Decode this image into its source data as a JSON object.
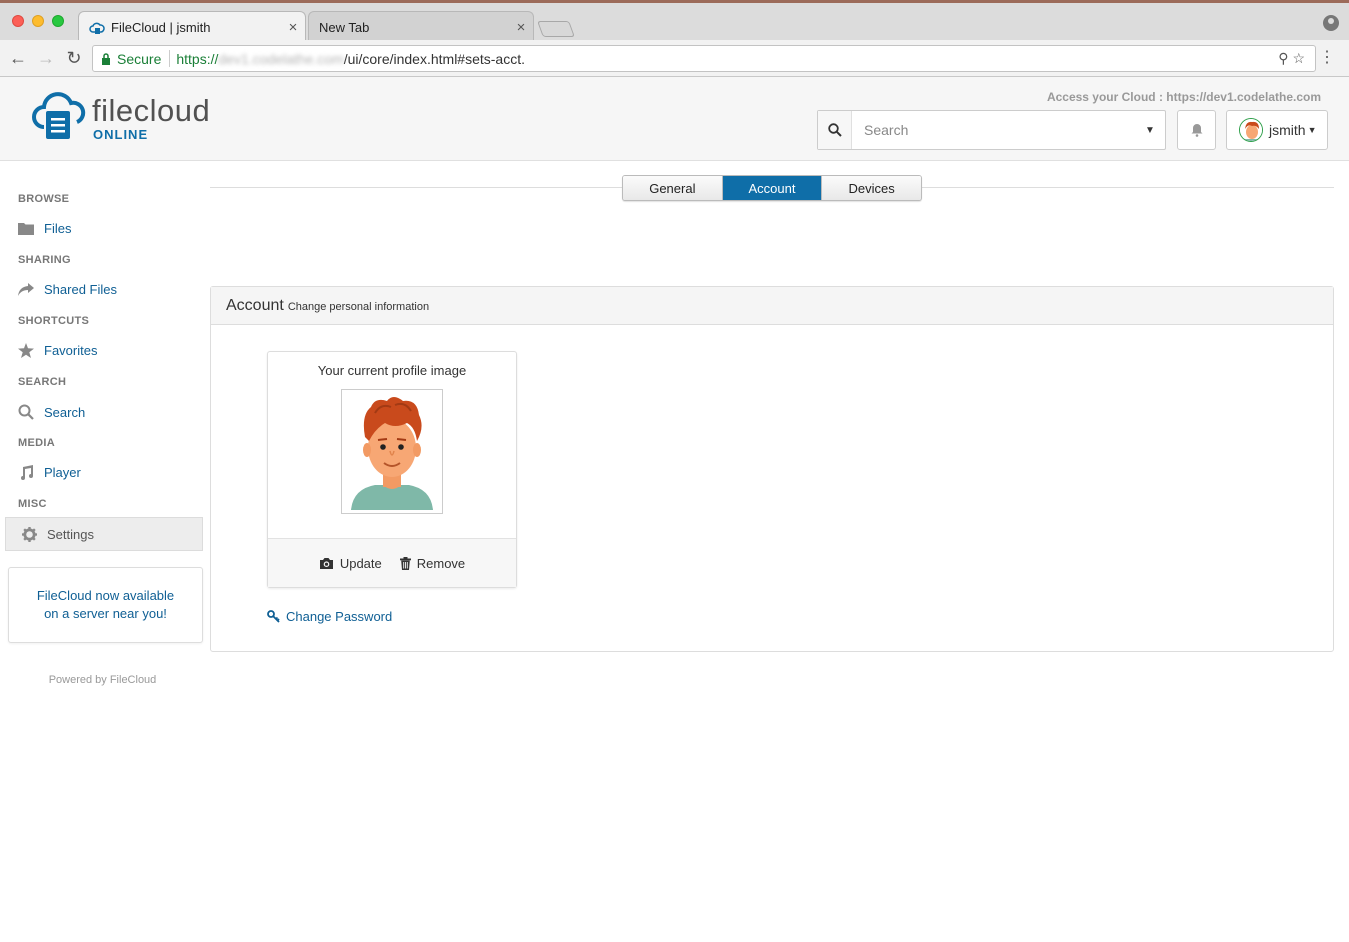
{
  "browser": {
    "tabs": [
      {
        "title": "FileCloud | jsmith",
        "close": "×"
      },
      {
        "title": "New Tab",
        "close": "×"
      }
    ],
    "secure_label": "Secure",
    "url_scheme": "https://",
    "url_host": "dev1.codelathe.com",
    "url_path": "/ui/core/index.html#sets-acct."
  },
  "header": {
    "logo_name": "filecloud",
    "logo_sub": "ONLINE",
    "access_text": "Access your Cloud : https://dev1.codelathe.com",
    "search_placeholder": "Search",
    "user_name": "jsmith"
  },
  "sidebar": {
    "sections": [
      {
        "heading": "BROWSE",
        "item": "Files",
        "icon": "folder-icon"
      },
      {
        "heading": "SHARING",
        "item": "Shared Files",
        "icon": "share-icon"
      },
      {
        "heading": "SHORTCUTS",
        "item": "Favorites",
        "icon": "star-icon"
      },
      {
        "heading": "SEARCH",
        "item": "Search",
        "icon": "search-icon"
      },
      {
        "heading": "MEDIA",
        "item": "Player",
        "icon": "music-icon"
      },
      {
        "heading": "MISC",
        "item": "Settings",
        "icon": "gear-icon"
      }
    ],
    "promo_line1": "FileCloud now available",
    "promo_line2": "on a server near you!",
    "powered": "Powered by FileCloud"
  },
  "main": {
    "tabs": [
      {
        "label": "General",
        "active": false
      },
      {
        "label": "Account",
        "active": true
      },
      {
        "label": "Devices",
        "active": false
      }
    ],
    "panel_title": "Account",
    "panel_subtitle": "Change personal information",
    "profile_label": "Your current profile image",
    "update_label": "Update",
    "remove_label": "Remove",
    "change_password_label": "Change Password"
  },
  "colors": {
    "accent": "#0f6ea8",
    "link": "#0f5f94"
  }
}
